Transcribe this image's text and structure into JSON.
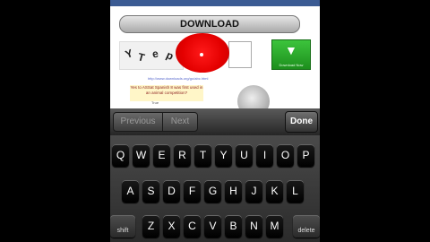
{
  "web": {
    "download_label": "DOWNLOAD",
    "captcha_glyphs": [
      "Y",
      "T",
      "e",
      "p"
    ],
    "green_button_label": "Download Now",
    "link_text": "http://www.downloads.org/go/abc.html",
    "question_text": "Yes to ASSat Spanish 8 was first used in an animal competition?",
    "answer_label": "True"
  },
  "toolbar": {
    "previous_label": "Previous",
    "next_label": "Next",
    "done_label": "Done"
  },
  "keyboard": {
    "row1": [
      "Q",
      "W",
      "E",
      "R",
      "T",
      "Y",
      "U",
      "I",
      "O",
      "P"
    ],
    "row2": [
      "A",
      "S",
      "D",
      "F",
      "G",
      "H",
      "J",
      "K",
      "L"
    ],
    "row3": [
      "Z",
      "X",
      "C",
      "V",
      "B",
      "N",
      "M"
    ],
    "shift_label": "shift",
    "delete_label": "delete"
  },
  "colors": {
    "red_marker": "#e40000",
    "green_button": "#2aa82a",
    "facebook_bar": "#3b5b93"
  }
}
